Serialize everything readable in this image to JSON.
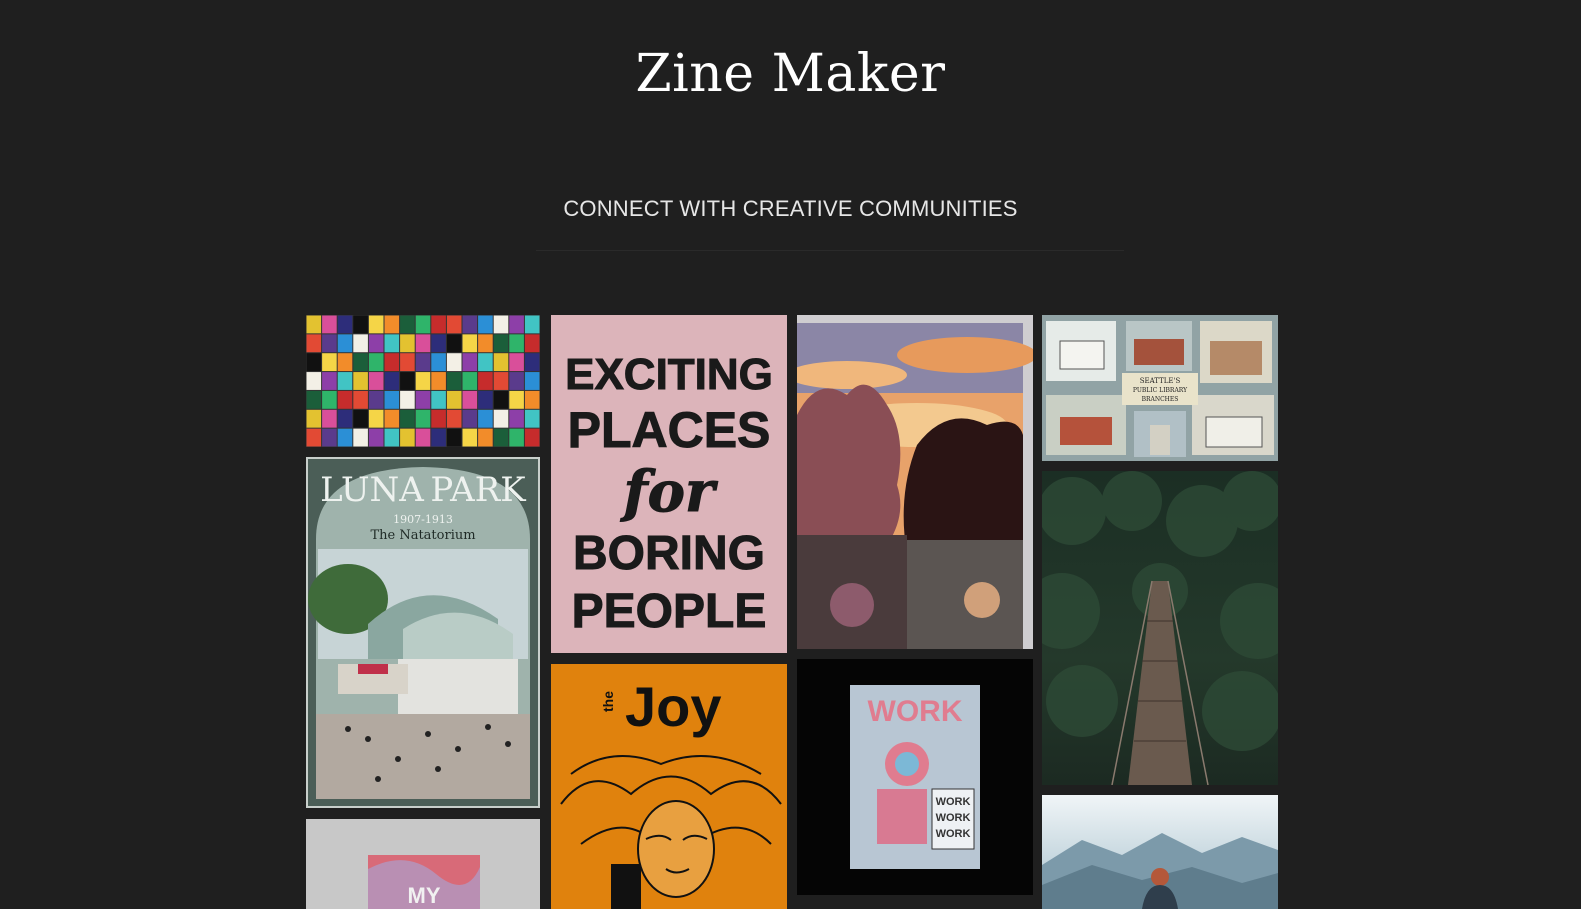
{
  "site": {
    "title": "Zine Maker",
    "tagline": "CONNECT WITH CREATIVE COMMUNITIES"
  },
  "gallery": {
    "tiles": [
      {
        "name": "zine-covers-collage",
        "text": []
      },
      {
        "name": "luna-park-poster",
        "text": [
          "LUNA",
          "PARK",
          "1907-1913",
          "The Natatorium"
        ]
      },
      {
        "name": "my-zine-cover",
        "text": [
          "MY"
        ]
      },
      {
        "name": "exciting-places-poster",
        "text": [
          "EXCITING",
          "PLACES",
          "for",
          "BORING",
          "PEOPLE"
        ]
      },
      {
        "name": "the-joy-cover",
        "text": [
          "the",
          "Joy"
        ]
      },
      {
        "name": "sunset-friends-illustration",
        "text": []
      },
      {
        "name": "work-zine-cover",
        "text": [
          "WORK",
          "WORK",
          "WORK",
          "WORK"
        ]
      },
      {
        "name": "seattle-libraries-postcard",
        "text": [
          "SEATTLE'S",
          "PUBLIC LIBRARY",
          "BRANCHES"
        ]
      },
      {
        "name": "forest-bridge-photo",
        "text": []
      },
      {
        "name": "mountain-view-photo",
        "text": []
      }
    ]
  },
  "colors": {
    "background": "#1f1f1f",
    "title": "#ffffff",
    "tagline": "#e6e6e6",
    "pink_poster": "#dcb4ba",
    "orange_cover": "#e0820d"
  }
}
